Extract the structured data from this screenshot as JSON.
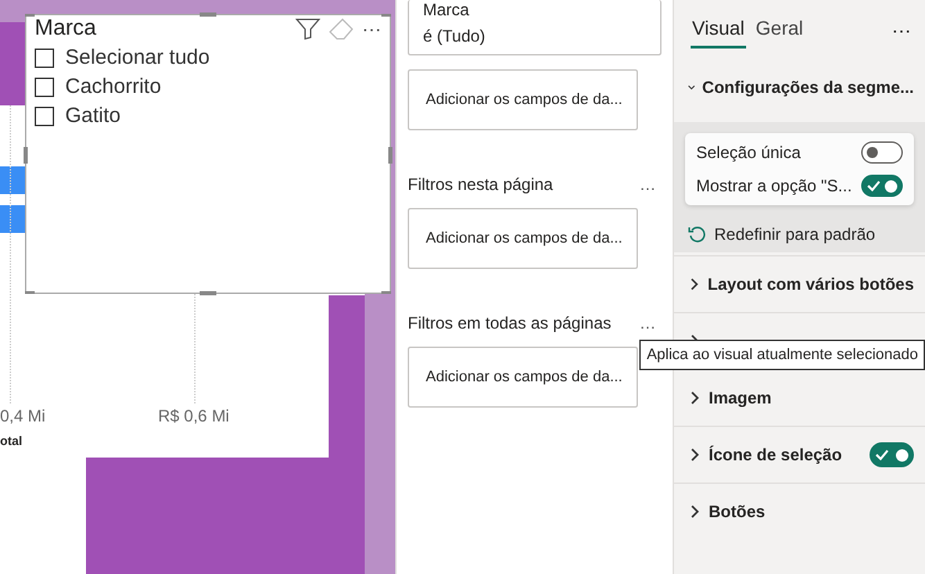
{
  "canvas": {
    "axis_labels": [
      "0,4 Mi",
      "R$ 0,6 Mi"
    ],
    "axis_title": "otal",
    "slicer": {
      "title": "Marca",
      "more": "⋯",
      "items": [
        {
          "label": "Selecionar tudo",
          "checked": false
        },
        {
          "label": "Cachorrito",
          "checked": false
        },
        {
          "label": "Gatito",
          "checked": false
        }
      ]
    }
  },
  "filter_pane": {
    "top_card": {
      "field": "Marca",
      "value": "é (Tudo)"
    },
    "visual_drop": "Adicionar os campos de da...",
    "sections": [
      {
        "title": "Filtros nesta página",
        "more": "…",
        "drop": "Adicionar os campos de da..."
      },
      {
        "title": "Filtros em todas as páginas",
        "more": "…",
        "drop": "Adicionar os campos de da..."
      }
    ]
  },
  "format_pane": {
    "tabs": [
      {
        "label": "Visual",
        "selected": true
      },
      {
        "label": "Geral",
        "selected": false
      }
    ],
    "more": "⋯",
    "expanded_section": {
      "title": "Configurações da segme...",
      "expanded": true,
      "options": [
        {
          "label": "Seleção única",
          "on": false
        },
        {
          "label": "Mostrar a opção \"S...",
          "on": true
        }
      ],
      "reset": "Redefinir para padrão"
    },
    "sections": [
      {
        "title": "Layout com vários botões",
        "expanded": false
      },
      {
        "expanded": false
      },
      {
        "title": "Imagem",
        "expanded": false
      },
      {
        "title": "Ícone de seleção",
        "expanded": false,
        "on": true
      },
      {
        "title": "Botões",
        "expanded": false
      }
    ]
  },
  "tooltip": "Aplica ao visual atualmente selecionado"
}
